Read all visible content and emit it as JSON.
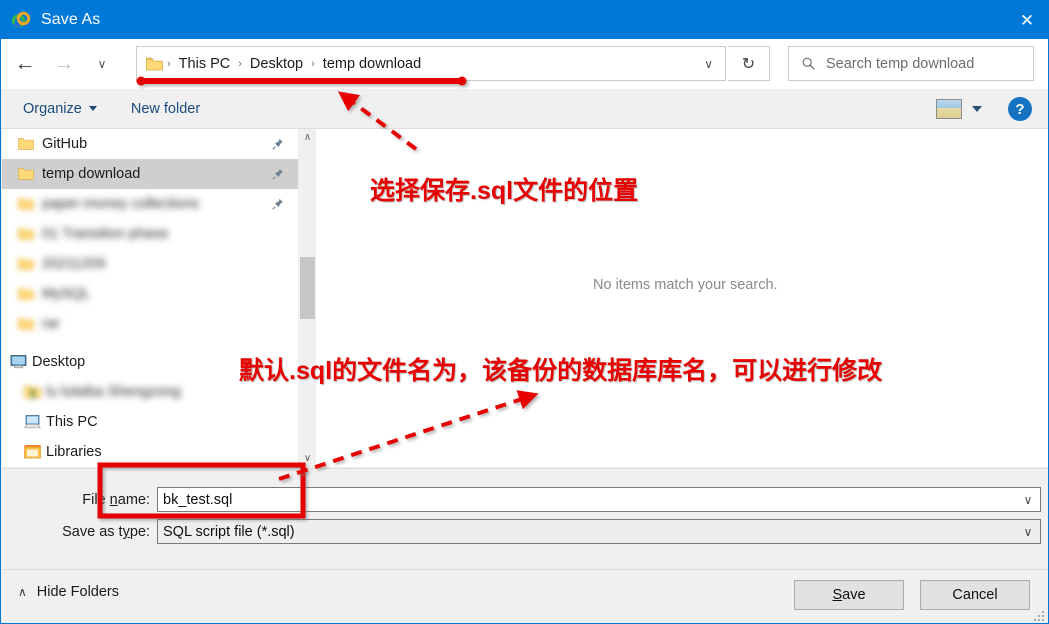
{
  "window": {
    "title": "Save As",
    "app_icon": "navicat-rings-icon",
    "close_label": "✕",
    "accent_color": "#0078d7"
  },
  "navbar": {
    "back_icon": "←",
    "forward_icon": "→",
    "recent_icon": "∨",
    "up_icon": "↑",
    "address": {
      "folder_icon": "folder-icon",
      "crumbs": [
        "This PC",
        "Desktop",
        "temp download"
      ],
      "separator": "›",
      "dropdown_icon": "∨"
    },
    "refresh_icon": "↻",
    "search": {
      "placeholder": "Search temp download",
      "icon": "search-icon"
    }
  },
  "commandbar": {
    "organize_label": "Organize",
    "new_folder_label": "New folder",
    "view_icon": "view-thumbnail-icon",
    "help_label": "?"
  },
  "nav_pane": {
    "quick_access": [
      {
        "label": "GitHub",
        "blurred": false,
        "selected": false,
        "pinned": true
      },
      {
        "label": "temp download",
        "blurred": false,
        "selected": true,
        "pinned": true
      },
      {
        "label": "paper-money collections",
        "blurred": true,
        "selected": false,
        "pinned": true
      },
      {
        "label": "01 Transition phase",
        "blurred": true,
        "selected": false,
        "pinned": false
      },
      {
        "label": "20211209",
        "blurred": true,
        "selected": false,
        "pinned": false
      },
      {
        "label": "MySQL",
        "blurred": true,
        "selected": false,
        "pinned": false
      },
      {
        "label": "rar",
        "blurred": true,
        "selected": false,
        "pinned": false
      }
    ],
    "roots": [
      {
        "label": "Desktop",
        "icon": "desktop-icon",
        "blurred": false
      },
      {
        "label": "lu lulaiba Shengzong",
        "icon": "user-folder-icon",
        "blurred": true
      },
      {
        "label": "This PC",
        "icon": "this-pc-icon",
        "blurred": false
      },
      {
        "label": "Libraries",
        "icon": "libraries-icon",
        "blurred": false
      }
    ],
    "scrollbar": {
      "up_icon": "∧",
      "down_icon": "∨"
    }
  },
  "file_pane": {
    "empty_message": "No items match your search."
  },
  "form": {
    "filename_label_pre": "File ",
    "filename_label_mnemonic": "n",
    "filename_label_post": "ame:",
    "filename_value": "bk_test.sql",
    "filetype_label_pre": "Save as t",
    "filetype_label_mnemonic": "y",
    "filetype_label_post": "pe:",
    "filetype_value": "SQL script file (*.sql)",
    "dropdown_icon": "∨"
  },
  "footer": {
    "hide_folders_label": "Hide Folders",
    "hide_folders_icon": "∧",
    "save_label_pre": "",
    "save_mnemonic": "S",
    "save_label_post": "ave",
    "cancel_label": "Cancel"
  },
  "annotations": {
    "color": "#e60000",
    "note_location": "选择保存.sql文件的位置",
    "note_filename": "默认.sql的文件名为，该备份的数据库库名，可以进行修改"
  }
}
